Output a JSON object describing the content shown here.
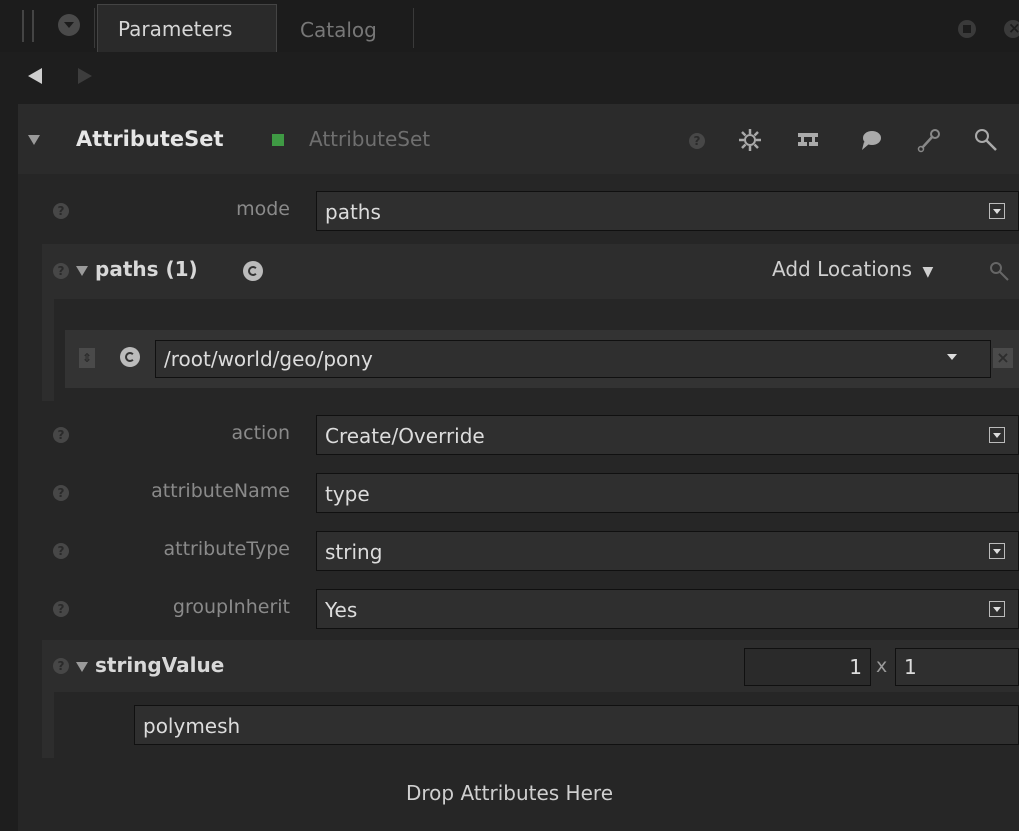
{
  "tabs": [
    {
      "label": "Parameters",
      "active": true
    },
    {
      "label": "Catalog",
      "active": false
    }
  ],
  "node": {
    "name": "AttributeSet",
    "type": "AttributeSet",
    "status_color": "#3f9a44",
    "toolbar_icons": [
      "help-icon",
      "gear-icon",
      "hierarchy-icon",
      "comment-icon",
      "wrench-icon",
      "search-icon"
    ]
  },
  "params": {
    "mode": {
      "label": "mode",
      "value": "paths"
    },
    "paths": {
      "title": "paths (1)",
      "add_locations": "Add Locations",
      "items": [
        "/root/world/geo/pony"
      ]
    },
    "action": {
      "label": "action",
      "value": "Create/Override"
    },
    "attributeName": {
      "label": "attributeName",
      "value": "type"
    },
    "attributeType": {
      "label": "attributeType",
      "value": "string"
    },
    "groupInherit": {
      "label": "groupInherit",
      "value": "Yes"
    },
    "stringValue": {
      "title": "stringValue",
      "rows": "1",
      "times": "x",
      "cols": "1",
      "value": "polymesh"
    }
  },
  "drop_text": "Drop Attributes Here"
}
